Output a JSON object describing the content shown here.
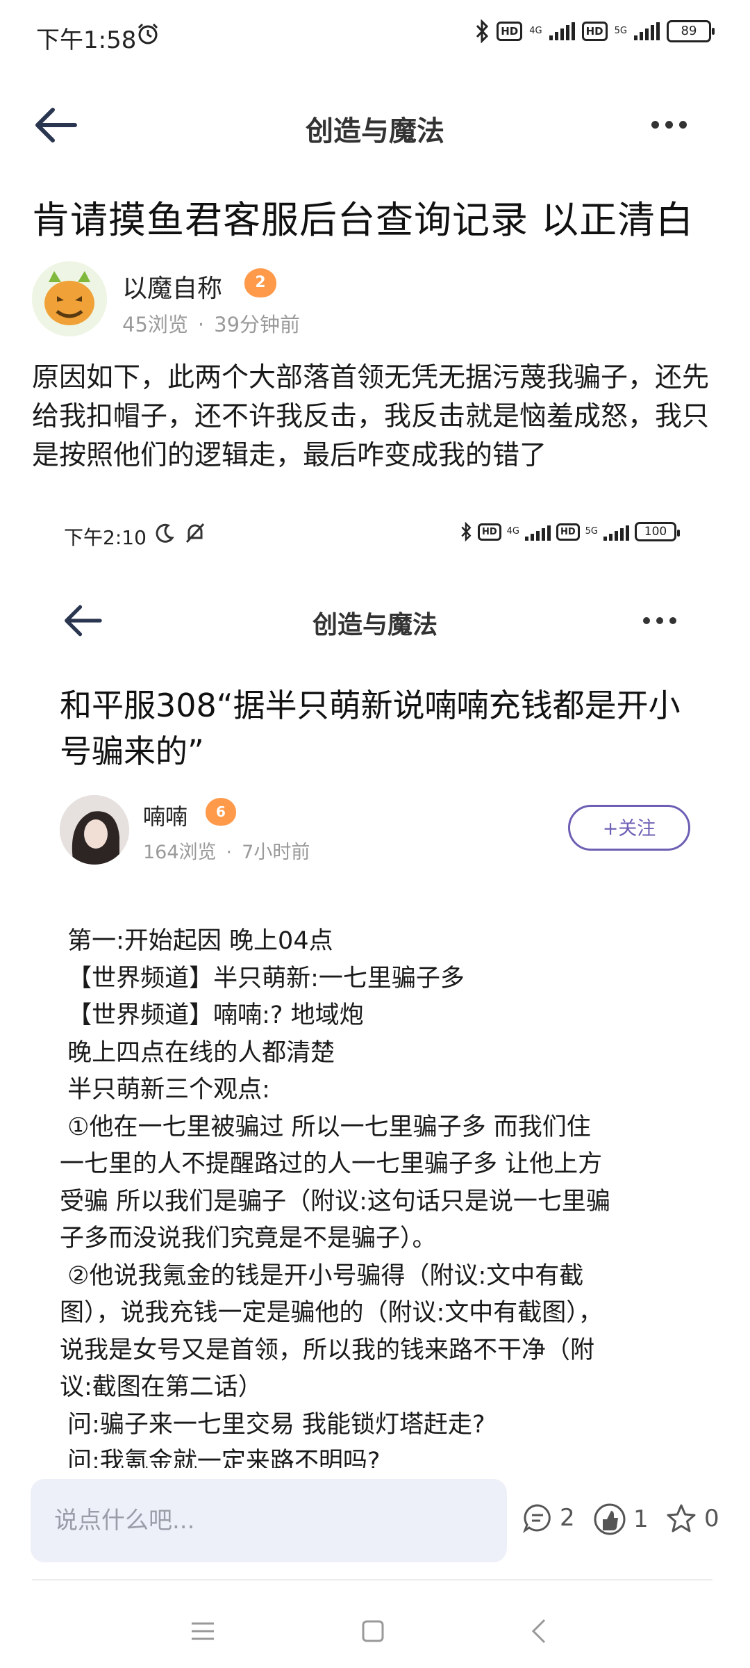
{
  "status_bar": {
    "time": "下午1:58",
    "network_1": "4G",
    "network_2": "5G",
    "hd_label": "HD",
    "battery": "89"
  },
  "nav": {
    "title": "创造与魔法"
  },
  "post": {
    "title": "肯请摸鱼君客服后台查询记录 以正清白",
    "author": "以魔自称",
    "level": "2",
    "views": "45浏览",
    "time_ago": "39分钟前",
    "body": "原因如下，此两个大部落首领无凭无据污蔑我骗子，还先给我扣帽子，还不许我反击，我反击就是恼羞成怒，我只是按照他们的逻辑走，最后咋变成我的错了"
  },
  "embedded": {
    "status": {
      "time": "下午2:10",
      "network_1": "4G",
      "network_2": "5G",
      "hd_label": "HD",
      "battery": "100"
    },
    "nav_title": "创造与魔法",
    "title": "和平服308“据半只萌新说喃喃充钱都是开小号骗来的”",
    "author": "喃喃",
    "level": "6",
    "views": "164浏览",
    "time_ago": "7小时前",
    "follow_label": "+关注",
    "lines": [
      " 第一:开始起因 晚上04点",
      " 【世界频道】半只萌新:一七里骗子多",
      " 【世界频道】喃喃:? 地域炮",
      " 晚上四点在线的人都清楚",
      " 半只萌新三个观点:",
      " ①他在一七里被骗过 所以一七里骗子多 而我们住",
      "一七里的人不提醒路过的人一七里骗子多 让他上方",
      "受骗 所以我们是骗子（附议:这句话只是说一七里骗",
      "子多而没说我们究竟是不是骗子）。",
      " ②他说我氪金的钱是开小号骗得（附议:文中有截",
      "图），说我充钱一定是骗他的（附议:文中有截图），",
      "说我是女号又是首领，所以我的钱来路不干净（附",
      "议:截图在第二话）",
      " 问:骗子来一七里交易 我能锁灯塔赶走?",
      " 问:我氪金就一定来路不明吗?"
    ]
  },
  "comment_bar": {
    "placeholder": "说点什么吧...",
    "comments": "2",
    "likes": "1",
    "stars": "0"
  }
}
